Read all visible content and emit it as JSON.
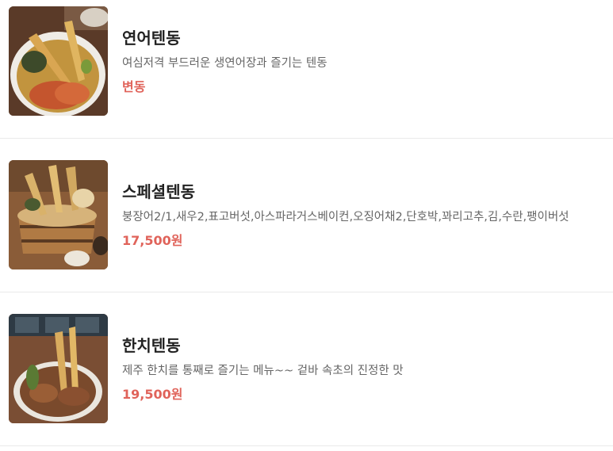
{
  "menu": {
    "items": [
      {
        "name": "연어텐동",
        "description": "여심저격 부드러운 생연어장과 즐기는 텐동",
        "price": "변동",
        "image": "salmon-tendon-photo"
      },
      {
        "name": "스페셜텐동",
        "description": "붕장어2/1,새우2,표고버섯,아스파라거스베이컨,오징어채2,단호박,꽈리고추,김,수란,팽이버섯",
        "price": "17,500원",
        "image": "special-tendon-photo"
      },
      {
        "name": "한치텐동",
        "description": "제주 한치를 통째로 즐기는 메뉴~~ 겉바 속초의 진정한 맛",
        "price": "19,500원",
        "image": "hanchi-tendon-photo"
      }
    ]
  },
  "colors": {
    "price": "#e0635a",
    "name": "#222222",
    "description": "#666666",
    "divider": "#eaeaea"
  }
}
